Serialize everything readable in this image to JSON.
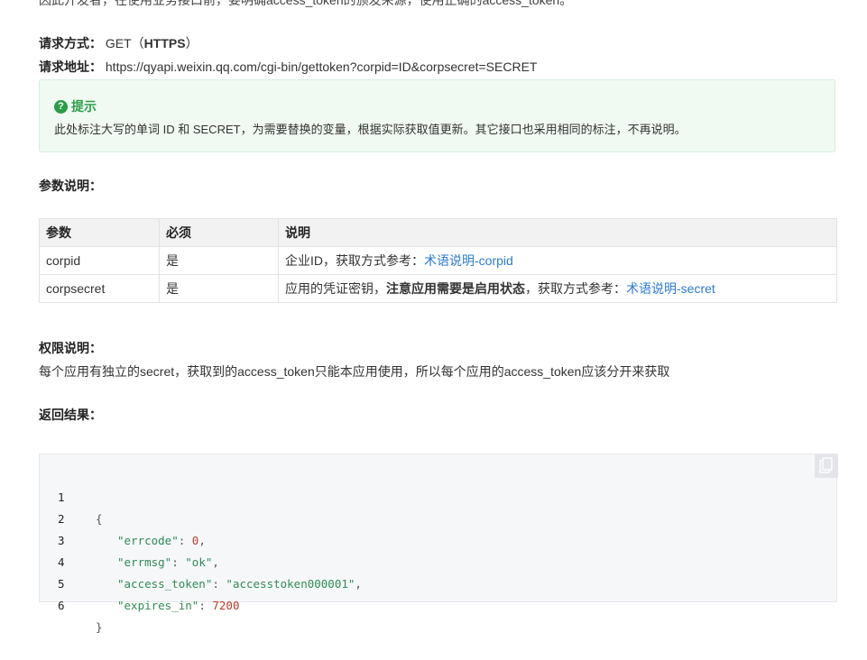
{
  "intro_cut": "因此开发者，在使用业务接口前，要明确access_token的颁发来源，使用正确的access_token。",
  "request": {
    "method_label": "请求方式：",
    "method_value": "GET（",
    "method_https": "HTTPS",
    "method_close": "）",
    "url_label": "请求地址：",
    "url_value": "https://qyapi.weixin.qq.com/cgi-bin/gettoken?corpid=ID&corpsecret=SECRET"
  },
  "tip": {
    "icon": "question-icon",
    "title": "提示",
    "text": "此处标注大写的单词 ID 和 SECRET，为需要替换的变量，根据实际获取值更新。其它接口也采用相同的标注，不再说明。"
  },
  "params_heading": "参数说明：",
  "params_table": {
    "headers": [
      "参数",
      "必须",
      "说明"
    ],
    "rows": [
      {
        "name": "corpid",
        "required": "是",
        "desc_prefix": "企业ID，获取方式参考：",
        "desc_bold": "",
        "desc_mid": "",
        "link": "术语说明-corpid"
      },
      {
        "name": "corpsecret",
        "required": "是",
        "desc_prefix": "应用的凭证密钥，",
        "desc_bold": "注意应用需要是启用状态",
        "desc_mid": "，获取方式参考：",
        "link": "术语说明-secret"
      }
    ]
  },
  "permission": {
    "heading": "权限说明：",
    "text": "每个应用有独立的secret，获取到的access_token只能本应用使用，所以每个应用的access_token应该分开来获取"
  },
  "result_heading": "返回结果：",
  "code": {
    "copy_icon": "copy-icon",
    "lines": [
      {
        "n": "1",
        "key": "",
        "sep": "",
        "val": "",
        "raw": "{"
      },
      {
        "n": "2",
        "key": "\"errcode\"",
        "sep": ": ",
        "val": "0",
        "tail": ","
      },
      {
        "n": "3",
        "key": "\"errmsg\"",
        "sep": ": ",
        "val": "\"ok\"",
        "tail": ","
      },
      {
        "n": "4",
        "key": "\"access_token\"",
        "sep": ": ",
        "val": "\"accesstoken000001\"",
        "tail": ","
      },
      {
        "n": "5",
        "key": "\"expires_in\"",
        "sep": ": ",
        "val": "7200",
        "tail": ""
      },
      {
        "n": "6",
        "key": "",
        "sep": "",
        "val": "",
        "raw": "}"
      }
    ]
  }
}
